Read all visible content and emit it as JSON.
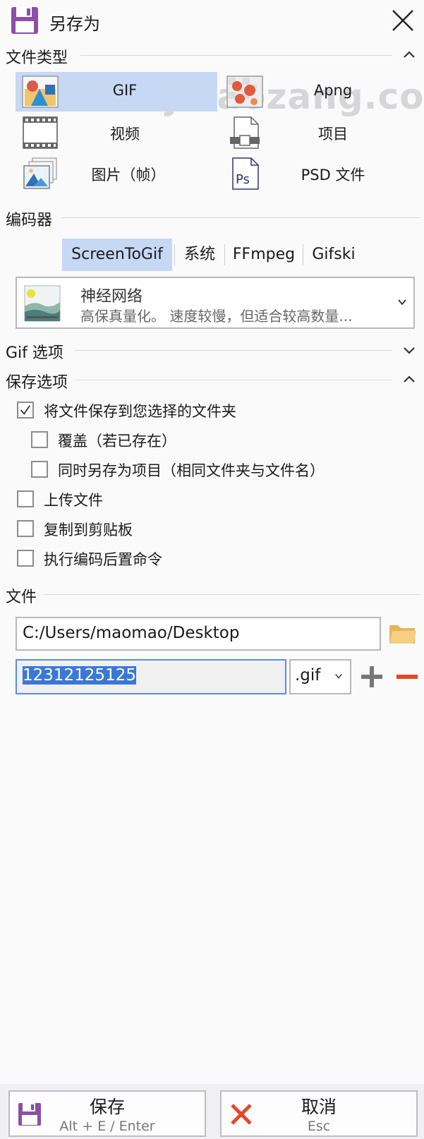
{
  "window": {
    "title": "另存为"
  },
  "watermark": "shejibaozang.co",
  "sections": {
    "file_type": "文件类型",
    "encoder": "编码器",
    "gif_options": "Gif 选项",
    "save_options": "保存选项",
    "file": "文件"
  },
  "file_types": [
    {
      "label": "GIF",
      "icon": "gif-image-icon",
      "selected": true
    },
    {
      "label": "Apng",
      "icon": "apng-image-icon",
      "selected": false
    },
    {
      "label": "视频",
      "icon": "video-film-icon",
      "selected": false
    },
    {
      "label": "项目",
      "icon": "project-file-icon",
      "selected": false
    },
    {
      "label": "图片（帧）",
      "icon": "image-frames-icon",
      "selected": false
    },
    {
      "label": "PSD 文件",
      "icon": "psd-file-icon",
      "selected": false
    }
  ],
  "encoders": {
    "tabs": [
      "ScreenToGif",
      "系统",
      "FFmpeg",
      "Gifski"
    ],
    "selected": "ScreenToGif",
    "quantizer": {
      "title": "神经网络",
      "description": "高保真量化。 速度较慢，但适合较高数量..."
    }
  },
  "save_options": [
    {
      "label": "将文件保存到您选择的文件夹",
      "checked": true
    },
    {
      "label": "覆盖（若已存在）",
      "checked": false
    },
    {
      "label": "同时另存为项目（相同文件夹与文件名）",
      "checked": false
    },
    {
      "label": "上传文件",
      "checked": false
    },
    {
      "label": "复制到剪贴板",
      "checked": false
    },
    {
      "label": "执行编码后置命令",
      "checked": false
    }
  ],
  "file": {
    "folder": "C:/Users/maomao/Desktop",
    "filename": "12312125125",
    "extension": ".gif"
  },
  "buttons": {
    "save": {
      "label": "保存",
      "shortcut": "Alt + E / Enter"
    },
    "cancel": {
      "label": "取消",
      "shortcut": "Esc"
    }
  },
  "colors": {
    "accent_selected": "#c6d8f4",
    "save_icon_purple": "#8b4fa8",
    "cancel_icon_red": "#e0492a",
    "remove_red": "#e0492a",
    "folder_orange": "#f2c06a"
  }
}
